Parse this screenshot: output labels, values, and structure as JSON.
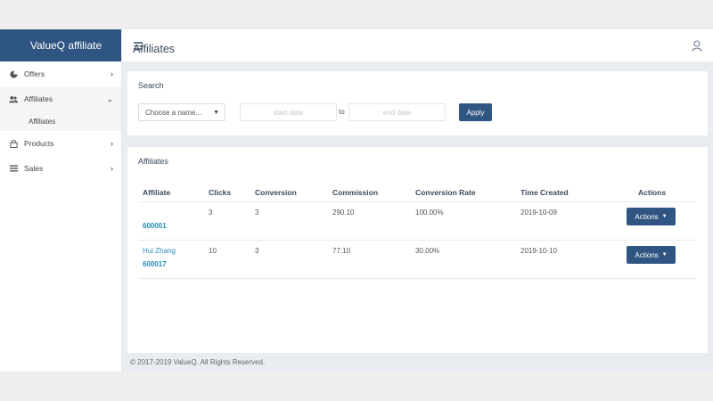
{
  "brand": {
    "title": "ValueQ affiliate"
  },
  "sidebar": {
    "items": [
      {
        "label": "Offers",
        "icon": "pie-chart-icon"
      },
      {
        "label": "Affiliates",
        "icon": "users-icon",
        "expanded": true,
        "sub": [
          {
            "label": "Affiliates"
          }
        ]
      },
      {
        "label": "Products",
        "icon": "bag-icon"
      },
      {
        "label": "Sales",
        "icon": "list-icon"
      }
    ]
  },
  "topbar": {
    "menu_icon": "hamburger-icon",
    "user_icon": "user-icon"
  },
  "page": {
    "title": "Affiliates"
  },
  "search": {
    "title": "Search",
    "name_select": "Choose a name...",
    "start_placeholder": "start date",
    "to_label": "to",
    "end_placeholder": "end date",
    "apply_label": "Apply"
  },
  "affiliates": {
    "title": "Affiliates",
    "columns": [
      "Affiliate",
      "Clicks",
      "Conversion",
      "Commission",
      "Conversion Rate",
      "Time Created",
      "Actions"
    ],
    "rows": [
      {
        "name": "",
        "id": "600001",
        "clicks": "3",
        "conversion": "3",
        "commission": "290.10",
        "rate": "100.00%",
        "created": "2019-10-09",
        "action": "Actions"
      },
      {
        "name": "Hui Zhang",
        "id": "600017",
        "clicks": "10",
        "conversion": "3",
        "commission": "77.10",
        "rate": "30.00%",
        "created": "2019-10-10",
        "action": "Actions"
      }
    ]
  },
  "footer": {
    "text": "© 2017-2019 ValueQ. All Rights Reserved."
  },
  "colors": {
    "brand": "#2f5582",
    "link": "#2a8ab8",
    "background": "#e9edf2"
  }
}
